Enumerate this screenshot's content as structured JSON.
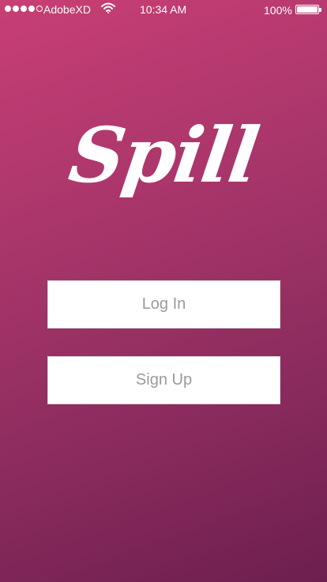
{
  "status_bar": {
    "carrier": "AdobeXD",
    "time": "10:34 AM",
    "battery_percent": "100%",
    "signal_bars_filled": 4,
    "signal_bars_total": 5,
    "battery_level": 1.0
  },
  "app": {
    "logo_text": "Spill"
  },
  "actions": {
    "login_label": "Log In",
    "signup_label": "Sign Up"
  },
  "colors": {
    "gradient_top": "#c83f74",
    "gradient_bottom": "#6d1f4f",
    "button_bg": "#ffffff",
    "button_text": "#9a9a9a"
  },
  "icons": {
    "wifi": "wifi-icon",
    "battery": "battery-icon",
    "signal": "signal-dots-icon"
  }
}
